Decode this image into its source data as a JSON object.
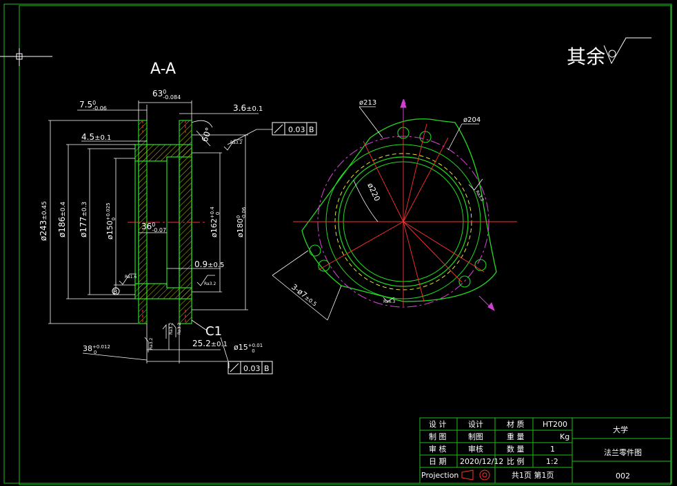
{
  "drawing": {
    "section_label": "A-A",
    "surface_note": "其余",
    "view_label_a": "A",
    "dims_left": {
      "d63": "63",
      "d63_tol": "0",
      "d63_tol_low": "-0.084",
      "d7_5": "7.5",
      "d7_5_tol": "0",
      "d7_5_tol_low": "-0.06",
      "d3_6": "3.6",
      "d3_6_tol": "±0.1",
      "d4_5": "4.5",
      "d4_5_tol": "±0.1",
      "angle60": "60°",
      "phi243": "ø243",
      "phi243_tol": "±0.45",
      "phi186": "ø186",
      "phi186_tol": "±0.4",
      "phi177": "ø177",
      "phi177_tol": "±0.3",
      "phi150": "ø150",
      "phi150_tol": "+0.025",
      "phi150_tol_low": "0",
      "d36": "36",
      "d36_tol": "0",
      "d36_tol_low": "-0.07",
      "phi162": "ø162",
      "phi162_tol": "+0.4",
      "phi162_tol_low": "0",
      "phi180": "ø180",
      "phi180_tol": "0",
      "phi180_tol_low": "-0.06",
      "d0_9": "0.9",
      "d0_9_tol": "±0.5",
      "chamfer": "C1",
      "d25_2": "25.2",
      "d25_2_tol": "±0.1",
      "phi15": "ø15",
      "phi15_tol": "+0.01",
      "phi15_tol_low": "0",
      "d38": "38",
      "d38_tol": "+0.012",
      "d38_tol_low": "0",
      "datum_b": "B",
      "gdt_value": "0.03",
      "gdt_datum": "B",
      "rough_1": "Ra3.2",
      "rough_2": "Ra1.6",
      "rough_3": "Ra3.2",
      "rough_4": "Ra3.2",
      "rough_5": "Ra3.2",
      "rough_6": "Ra3.2"
    },
    "dims_right": {
      "phi213": "ø213",
      "phi204": "ø204",
      "phi220": "ø220",
      "holes": "3-ø7",
      "holes_tol": "±0.5",
      "rough_r1": "Ra3.2",
      "rough_r2": "Ra6.3"
    }
  },
  "title_block": {
    "rows": [
      {
        "l1": "设 计",
        "v1": "设计",
        "l2": "材 质",
        "v2": "HT200"
      },
      {
        "l1": "制 图",
        "v1": "制图",
        "l2": "重 量",
        "v2": "Kg"
      },
      {
        "l1": "审 核",
        "v1": "审核",
        "l2": "数 量",
        "v2": "1"
      },
      {
        "l1": "日 期",
        "v1": "2020/12/12",
        "l2": "比 例",
        "v2": "1:2"
      }
    ],
    "projection": "Projection",
    "sheet": "共1页 第1页",
    "university": "大学",
    "part_name": "法兰零件图",
    "drawing_no": "002"
  },
  "colors": {
    "frame": "#1fbf1f",
    "outline": "#22dd22",
    "dimension": "#ffffff",
    "center": "#ff2020",
    "hidden": "#ffff40",
    "accent": "#d040d0",
    "bolt": "#ff4040"
  }
}
